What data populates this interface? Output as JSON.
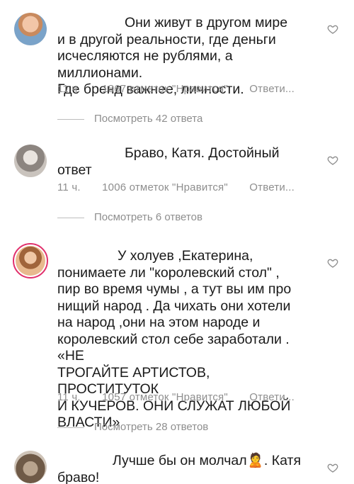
{
  "comments": [
    {
      "text": "Они живут в другом мире\nи в другой реальности, где деньги\nисчесляются не рублями, а миллионами.\nГде бренд важнее, личности.",
      "time": "11 ч.",
      "likes": "1867 отметок \"Нравится\"",
      "reply": "Ответи...",
      "view_replies": "Посмотреть 42 ответа"
    },
    {
      "text": "Браво, Катя. Достойный\nответ",
      "time": "11 ч.",
      "likes": "1006 отметок \"Нравится\"",
      "reply": "Ответи...",
      "view_replies": "Посмотреть 6 ответов"
    },
    {
      "text": "У  холуев ,Екатерина,\nпонимаете ли \"королевский стол\" ,\nпир во время чумы , а тут вы им про\nнищий народ . Да чихать они хотели\nна народ ,они на этом народе и\nкоролевский стол себе заработали . «НЕ\nТРОГАЙТЕ АРТИСТОВ, ПРОСТИТУТОК\nИ КУЧЕРОВ. ОНИ СЛУЖАТ ЛЮБОЙ\nВЛАСТИ»",
      "time": "11 ч.",
      "likes": "1057 отметок \"Нравится\"",
      "reply": "Ответи...",
      "view_replies": "Посмотреть 28 ответов"
    },
    {
      "text": "Лучше бы он молчал🙎. Катя\nбраво!",
      "time": "",
      "likes": "",
      "reply": "",
      "view_replies": ""
    }
  ],
  "icons": {
    "like": "heart-outline-icon"
  },
  "colors": {
    "muted": "#8e8e8e",
    "ring": "#e1306c"
  }
}
